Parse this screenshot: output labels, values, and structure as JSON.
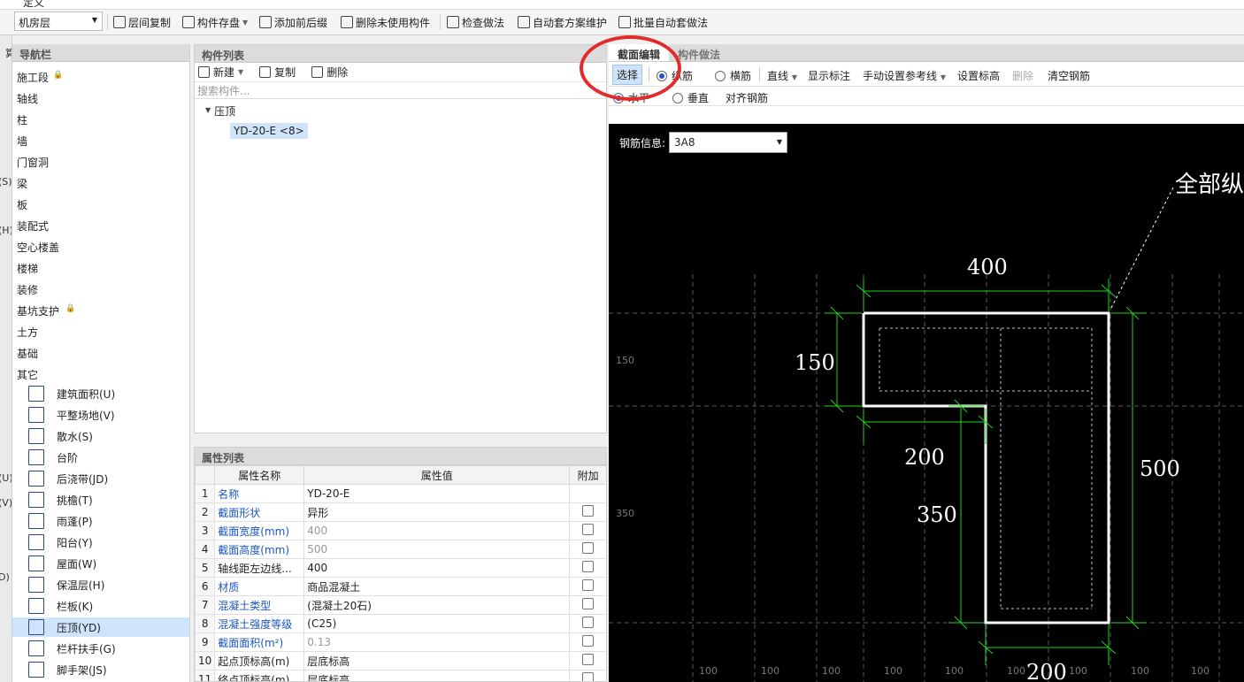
{
  "top": {
    "menu_fragment": "定义"
  },
  "toolbar": {
    "floor": "机房层",
    "buttons": [
      "层间复制",
      "构件存盘",
      "添加前后缀",
      "删除未使用构件",
      "检查做法",
      "自动套方案维护",
      "批量自动套做法"
    ]
  },
  "edge": {
    "letters": [
      "生",
      "选",
      "算",
      "(S)",
      "(H)",
      "(U)",
      "(V)",
      "D)"
    ]
  },
  "nav": {
    "title": "导航栏",
    "items": [
      "施工段",
      "轴线",
      "柱",
      "墙",
      "门窗洞",
      "梁",
      "板",
      "装配式",
      "空心楼盖",
      "楼梯",
      "装修",
      "基坑支护",
      "土方",
      "基础",
      "其它"
    ],
    "sub_items": [
      "建筑面积(U)",
      "平整场地(V)",
      "散水(S)",
      "台阶",
      "后浇带(JD)",
      "挑檐(T)",
      "雨蓬(P)",
      "阳台(Y)",
      "屋面(W)",
      "保温层(H)",
      "栏板(K)",
      "压顶(YD)",
      "栏杆扶手(G)",
      "脚手架(JS)"
    ],
    "selected": "压顶(YD)"
  },
  "component": {
    "title": "构件列表",
    "new_label": "新建",
    "copy_label": "复制",
    "delete_label": "删除",
    "search_placeholder": "搜索构件...",
    "tree_root": "压顶",
    "tree_child": "YD-20-E <8>"
  },
  "props": {
    "title": "属性列表",
    "headers": [
      "属性名称",
      "属性值",
      "附加"
    ],
    "rows": [
      {
        "n": "1",
        "name": "名称",
        "value": "YD-20-E"
      },
      {
        "n": "2",
        "name": "截面形状",
        "value": "异形"
      },
      {
        "n": "3",
        "name": "截面宽度(mm)",
        "value": "400"
      },
      {
        "n": "4",
        "name": "截面高度(mm)",
        "value": "500"
      },
      {
        "n": "5",
        "name": "轴线距左边线...",
        "value": "400"
      },
      {
        "n": "6",
        "name": "材质",
        "value": "商品混凝土"
      },
      {
        "n": "7",
        "name": "混凝土类型",
        "value": "(混凝土20石)"
      },
      {
        "n": "8",
        "name": "混凝土强度等级",
        "value": "(C25)"
      },
      {
        "n": "9",
        "name": "截面面积(m²)",
        "value": "0.13"
      },
      {
        "n": "10",
        "name": "起点顶标高(m)",
        "value": "层底标高"
      },
      {
        "n": "11",
        "name": "终点顶标高(m)",
        "value": "层底标高"
      }
    ]
  },
  "right": {
    "tab_active": "截面编辑",
    "tab_other": "构件做法",
    "select": "选择",
    "longitudinal": "纵筋",
    "transverse": "横筋",
    "line": "直线",
    "show_annot": "显示标注",
    "manual_ref": "手动设置参考线",
    "set_elev": "设置标高",
    "delete": "删除",
    "clear": "清空钢筋",
    "horizontal": "水平",
    "vertical": "垂直",
    "align": "对齐钢筋",
    "rebar_info_label": "钢筋信息:",
    "rebar_info_value": "3A8"
  },
  "drawing": {
    "dim_400": "400",
    "dim_150": "150",
    "dim_200_mid": "200",
    "dim_500": "500",
    "dim_350": "350",
    "dim_200_bottom": "200",
    "label_all": "全部纵",
    "left_150": "150",
    "left_350": "350",
    "bottom_100": "100"
  }
}
